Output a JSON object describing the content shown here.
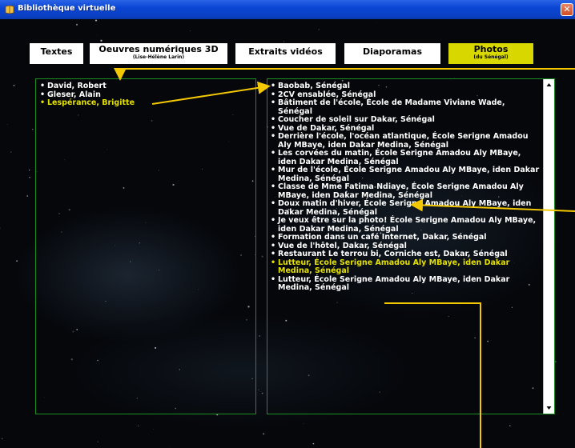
{
  "window": {
    "title": "Bibliothèque virtuelle",
    "close_glyph": "✕"
  },
  "tabs": [
    {
      "label": "Textes",
      "sub": ""
    },
    {
      "label": "Oeuvres numériques 3D",
      "sub": "(Lise-Hélène Larin)"
    },
    {
      "label": "Extraits vidéos",
      "sub": ""
    },
    {
      "label": "Diaporamas",
      "sub": ""
    },
    {
      "label": "Photos",
      "sub": "(du Sénégal)"
    }
  ],
  "authors": [
    "David, Robert",
    "Gleser, Alain",
    "Lespérance, Brigitte"
  ],
  "photos": [
    "Baobab, Sénégal",
    "2CV ensablée, Sénégal",
    "Bâtiment de l'école, École de Madame Viviane Wade, Sénégal",
    "Coucher de soleil sur Dakar, Sénégal",
    "Vue de Dakar, Sénégal",
    "Derrière l'école, l'océan atlantique, École Serigne Amadou Aly MBaye, iden Dakar Medina, Sénégal",
    "Les corvées du matin, École Serigne Amadou Aly MBaye, iden Dakar Medina, Sénégal",
    "Mur de l'école, École Serigne Amadou Aly MBaye, iden Dakar Medina, Sénégal",
    "Classe de Mme Fatima Ndiaye, École Serigne Amadou Aly MBaye, iden Dakar Medina, Sénégal",
    "Doux matin d'hiver, École Serigne Amadou Aly MBaye, iden Dakar Medina, Sénégal",
    "Je veux être sur la photo! École Serigne Amadou Aly MBaye, iden Dakar Medina, Sénégal",
    "Formation dans un café Internet, Dakar, Sénégal",
    "Vue de l'hôtel, Dakar, Sénégal",
    "Restaurant Le terrou bi, Corniche est, Dakar, Sénégal",
    "Lutteur, École Serigne Amadou Aly MBaye, iden Dakar Medina, Sénégal",
    "Lutteur, École Serigne Amadou Aly MBaye, iden Dakar Medina, Sénégal"
  ],
  "colors": {
    "highlight": "#e4e000",
    "panel_border": "#1b8f22",
    "active_tab": "#d8d800",
    "titlebar": "#0a46d4"
  },
  "icons": {
    "app": "book-icon",
    "close": "close-icon",
    "scroll_up": "scroll-up-icon",
    "scroll_down": "scroll-down-icon"
  }
}
